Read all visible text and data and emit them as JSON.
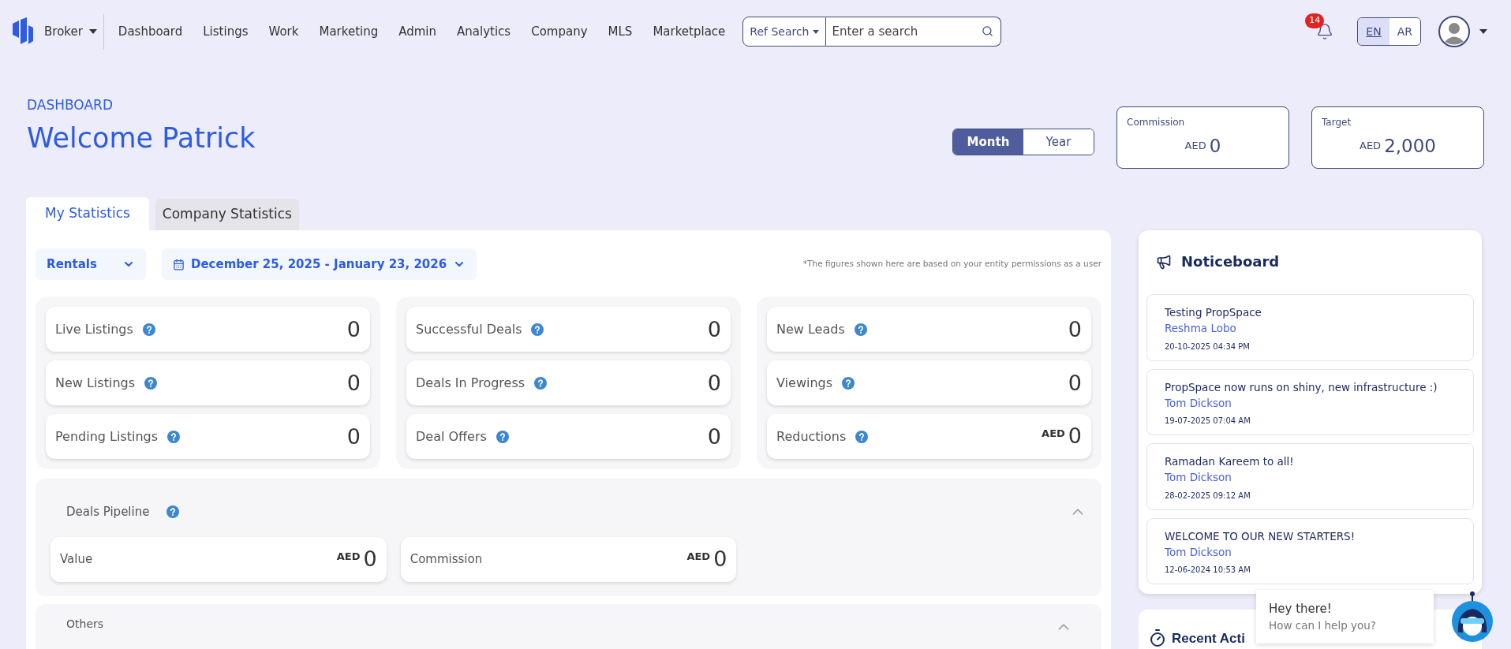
{
  "nav": {
    "role": "Broker",
    "items": [
      "Dashboard",
      "Listings",
      "Work",
      "Marketing",
      "Admin",
      "Analytics",
      "Company",
      "MLS",
      "Marketplace"
    ]
  },
  "search": {
    "scope": "Ref Search",
    "placeholder": "Enter a search"
  },
  "notifications": {
    "count": "14"
  },
  "languages": [
    {
      "label": "EN",
      "selected": true
    },
    {
      "label": "AR",
      "selected": false
    }
  ],
  "header": {
    "eyebrow": "DASHBOARD",
    "title": "Welcome Patrick"
  },
  "period": [
    {
      "label": "Month",
      "selected": true
    },
    {
      "label": "Year",
      "selected": false
    }
  ],
  "summary": [
    {
      "label": "Commission",
      "currency": "AED",
      "value": "0"
    },
    {
      "label": "Target",
      "currency": "AED",
      "value": "2,000"
    }
  ],
  "tabs": [
    {
      "label": "My Statistics",
      "selected": true
    },
    {
      "label": "Company Statistics",
      "selected": false
    }
  ],
  "filters": {
    "type": "Rentals",
    "date_range": "December 25, 2025 - January 23, 2026",
    "note": "*The figures shown here are based on your entity permissions as a user"
  },
  "stat_groups": [
    [
      {
        "label": "Live Listings",
        "value": "0"
      },
      {
        "label": "New Listings",
        "value": "0"
      },
      {
        "label": "Pending Listings",
        "value": "0"
      }
    ],
    [
      {
        "label": "Successful Deals",
        "value": "0"
      },
      {
        "label": "Deals In Progress",
        "value": "0"
      },
      {
        "label": "Deal Offers",
        "value": "0"
      }
    ],
    [
      {
        "label": "New Leads",
        "value": "0"
      },
      {
        "label": "Viewings",
        "value": "0"
      },
      {
        "label": "Reductions",
        "currency": "AED",
        "value": "0"
      }
    ]
  ],
  "pipeline": {
    "title": "Deals Pipeline",
    "expanded": true,
    "cards": [
      {
        "label": "Value",
        "currency": "AED",
        "value": "0"
      },
      {
        "label": "Commission",
        "currency": "AED",
        "value": "0"
      }
    ]
  },
  "others": {
    "title": "Others",
    "expanded": true
  },
  "noticeboard": {
    "title": "Noticeboard",
    "notices": [
      {
        "title": "Testing PropSpace",
        "author": "Reshma Lobo",
        "date": "20-10-2025 04:34 PM"
      },
      {
        "title": "PropSpace now runs on shiny, new infrastructure :)",
        "author": "Tom Dickson",
        "date": "19-07-2025 07:04 AM"
      },
      {
        "title": "Ramadan Kareem to all!",
        "author": "Tom Dickson",
        "date": "28-02-2025 09:12 AM"
      },
      {
        "title": "WELCOME TO OUR NEW STARTERS!",
        "author": "Tom Dickson",
        "date": "12-06-2024 10:53 AM"
      }
    ]
  },
  "recent_activity": {
    "title": "Recent Acti"
  },
  "chat": {
    "greeting": "Hey there!",
    "prompt": "How can I help you?"
  }
}
